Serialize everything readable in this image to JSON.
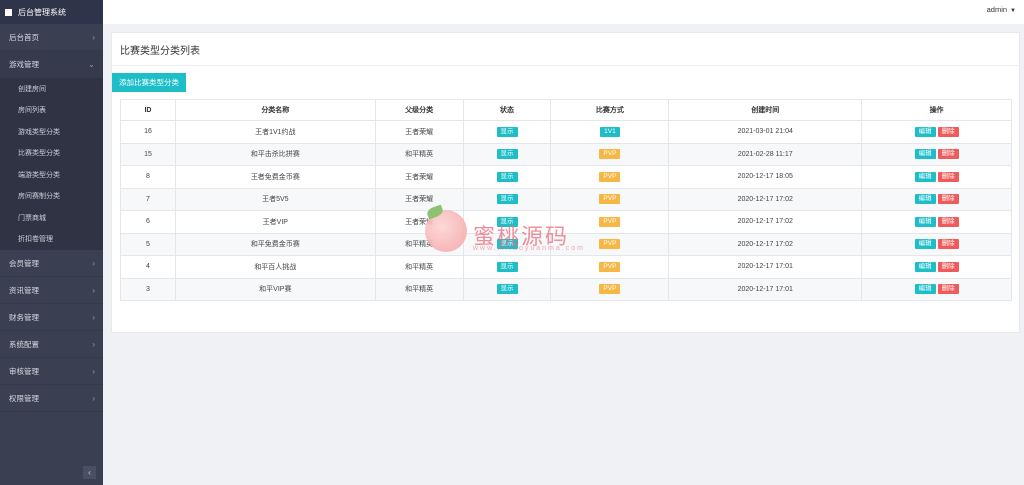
{
  "brand": "后台管理系统",
  "user": "admin",
  "nav": [
    {
      "label": "后台首页",
      "chevron": "›"
    },
    {
      "label": "游戏管理",
      "chevron": "⌄",
      "open": true
    },
    {
      "label": "会员管理",
      "chevron": "›"
    },
    {
      "label": "资讯管理",
      "chevron": "›"
    },
    {
      "label": "财务管理",
      "chevron": "›"
    },
    {
      "label": "系统配置",
      "chevron": "›"
    },
    {
      "label": "审核管理",
      "chevron": "›"
    },
    {
      "label": "权限管理",
      "chevron": "›"
    }
  ],
  "subnav": [
    "创建房间",
    "房间列表",
    "游戏类型分类",
    "比赛类型分类",
    "端游类型分类",
    "房间赛制分类",
    "门票商城",
    "折扣卷管理"
  ],
  "collapse": "‹",
  "panel_title": "比赛类型分类列表",
  "add_button": "添加比赛类型分类",
  "table": {
    "headers": [
      "ID",
      "分类名称",
      "父级分类",
      "状态",
      "比赛方式",
      "创建时间",
      "操作"
    ],
    "rows": [
      {
        "id": "16",
        "name": "王者1V1约战",
        "parent": "王者荣耀",
        "status": "显示",
        "mode": "1V1",
        "time": "2021-03-01 21:04"
      },
      {
        "id": "15",
        "name": "和平击杀比拼赛",
        "parent": "和平精英",
        "status": "显示",
        "mode": "PVP",
        "time": "2021-02-28 11:17"
      },
      {
        "id": "8",
        "name": "王者免费金币赛",
        "parent": "王者荣耀",
        "status": "显示",
        "mode": "PVP",
        "time": "2020-12-17 18:05"
      },
      {
        "id": "7",
        "name": "王者5V5",
        "parent": "王者荣耀",
        "status": "显示",
        "mode": "PVP",
        "time": "2020-12-17 17:02"
      },
      {
        "id": "6",
        "name": "王者VIP",
        "parent": "王者荣耀",
        "status": "显示",
        "mode": "PVP",
        "time": "2020-12-17 17:02"
      },
      {
        "id": "5",
        "name": "和平免费金币赛",
        "parent": "和平精英",
        "status": "显示",
        "mode": "PVP",
        "time": "2020-12-17 17:02"
      },
      {
        "id": "4",
        "name": "和平百人挑战",
        "parent": "和平精英",
        "status": "显示",
        "mode": "PVP",
        "time": "2020-12-17 17:01"
      },
      {
        "id": "3",
        "name": "和平VIP赛",
        "parent": "和平精英",
        "status": "显示",
        "mode": "PVP",
        "time": "2020-12-17 17:01"
      }
    ],
    "edit_label": "编辑",
    "delete_label": "删除"
  },
  "watermark": {
    "text": "蜜桃源码",
    "url": "www.mitaoyuanma.com"
  },
  "colors": {
    "sidebar": "#3a3f51",
    "accent": "#1dbec8",
    "pvp": "#f6b745",
    "danger": "#ef5a5a"
  }
}
